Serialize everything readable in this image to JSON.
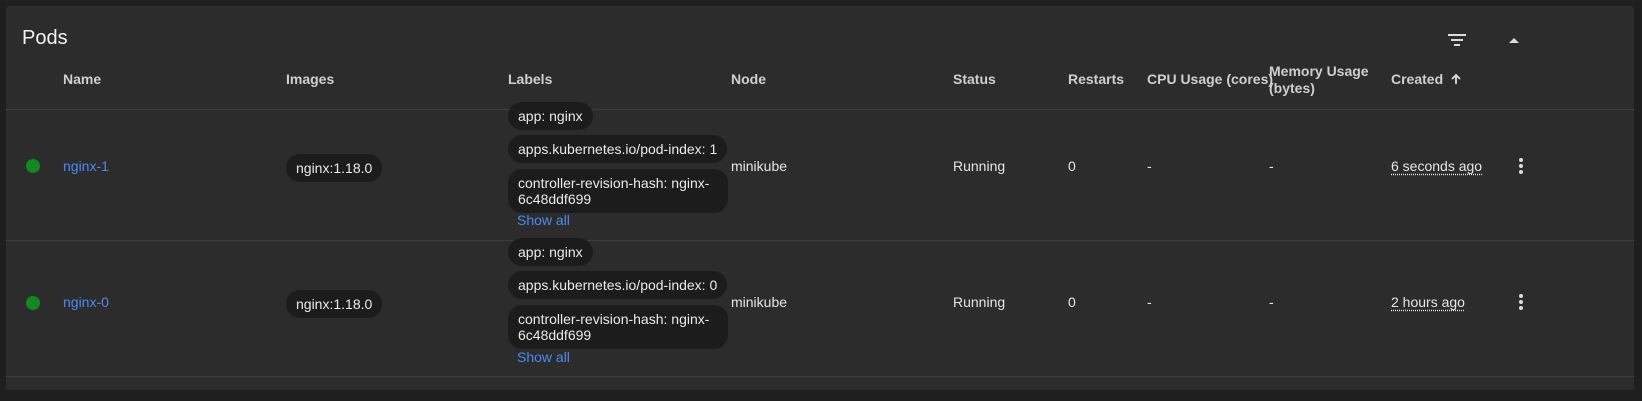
{
  "card": {
    "title": "Pods"
  },
  "toolbar": {
    "filter_icon": "filter-icon",
    "collapse_icon": "chevron-up-icon"
  },
  "columns": {
    "name": "Name",
    "images": "Images",
    "labels": "Labels",
    "node": "Node",
    "status": "Status",
    "restarts": "Restarts",
    "cpu": "CPU Usage (cores)",
    "memory_line1": "Memory Usage",
    "memory_line2": "(bytes)",
    "created": "Created",
    "created_sort_icon": "arrow-up-icon"
  },
  "rows": [
    {
      "status_color": "#0f8a1e",
      "name": "nginx-1",
      "image": "nginx:1.18.0",
      "labels": [
        "app: nginx",
        "apps.kubernetes.io/pod-index: 1",
        "controller-revision-hash: nginx-6c48ddf699"
      ],
      "show_all": "Show all",
      "node": "minikube",
      "status": "Running",
      "restarts": "0",
      "cpu": "-",
      "memory": "-",
      "created": "6 seconds ago"
    },
    {
      "status_color": "#0f8a1e",
      "name": "nginx-0",
      "image": "nginx:1.18.0",
      "labels": [
        "app: nginx",
        "apps.kubernetes.io/pod-index: 0",
        "controller-revision-hash: nginx-6c48ddf699"
      ],
      "show_all": "Show all",
      "node": "minikube",
      "status": "Running",
      "restarts": "0",
      "cpu": "-",
      "memory": "-",
      "created": "2 hours ago"
    }
  ]
}
